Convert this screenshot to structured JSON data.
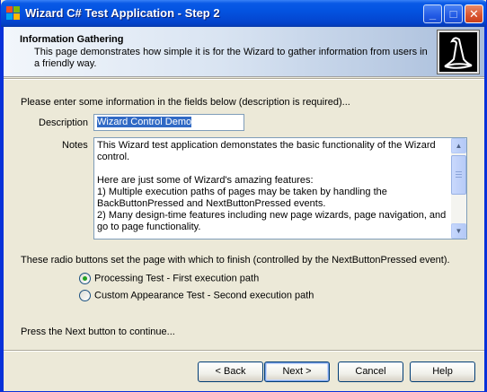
{
  "window": {
    "title": "Wizard C# Test Application - Step 2",
    "controls": {
      "minimize": "_",
      "maximize": "□",
      "close": "✕"
    }
  },
  "header": {
    "title": "Information Gathering",
    "description": "This page demonstrates how simple it is for the Wizard to gather information from users in a friendly way.",
    "logo_icon": "wizard-hat-icon"
  },
  "form": {
    "instructions": "Please enter some information in the fields below (description is required)...",
    "description_label": "Description",
    "description_value": "Wizard Control Demo",
    "notes_label": "Notes",
    "notes_value": "This Wizard test application demonstates the basic functionality of the Wizard control.\n\nHere are just some of Wizard's amazing features:\n1) Multiple execution paths of pages may be taken by handling the BackButtonPressed and NextButtonPressed events.\n2) Many design-time features including new page wizards, page navigation, and go to page functionality."
  },
  "radio_section": {
    "instructions": "These radio buttons set the page with which to finish (controlled by the NextButtonPressed event).",
    "options": [
      {
        "label": "Processing Test - First execution path",
        "checked": true
      },
      {
        "label": "Custom Appearance Test - Second execution path",
        "checked": false
      }
    ]
  },
  "footer": {
    "continue_text": "Press the Next button to continue...",
    "buttons": {
      "back": "< Back",
      "next": "Next >",
      "cancel": "Cancel",
      "help": "Help"
    }
  },
  "colors": {
    "titlebar": "#0454e2",
    "window_bg": "#ece9d8",
    "selection": "#316ac5",
    "radio_check": "#21a121"
  }
}
